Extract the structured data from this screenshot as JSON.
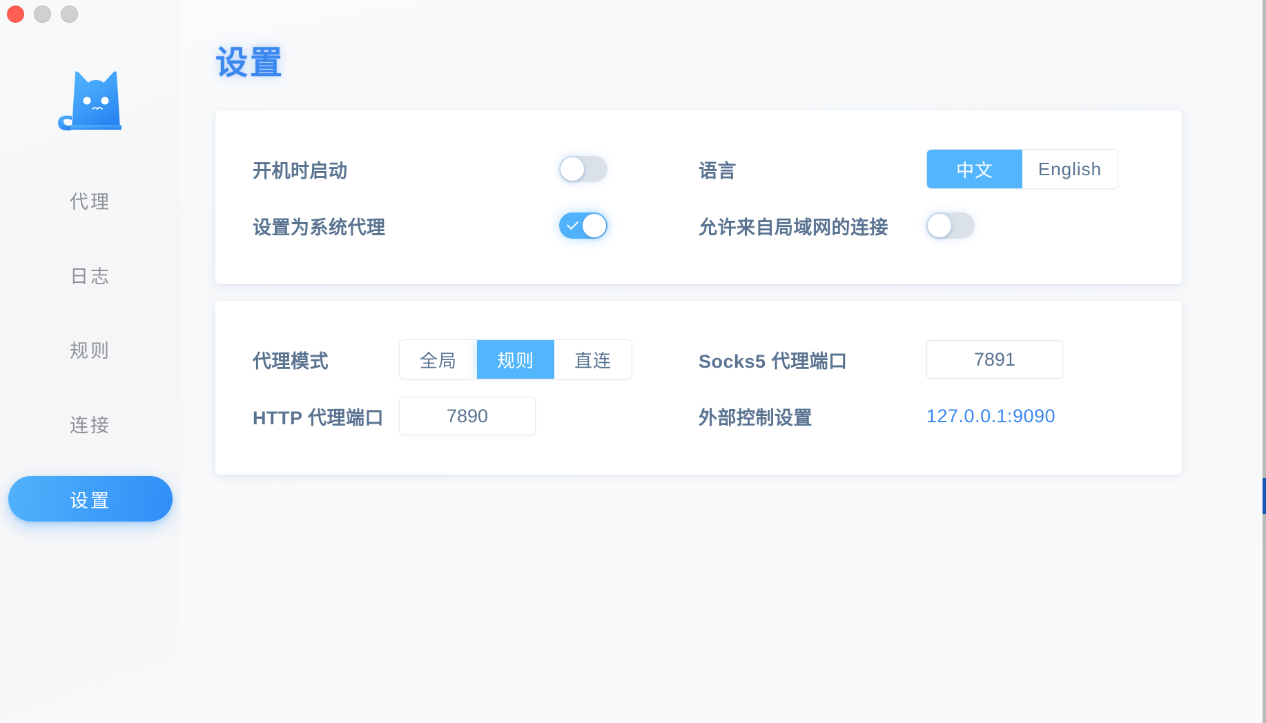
{
  "window": {
    "traffic_lights": [
      {
        "name": "close",
        "color": "#ff5f52"
      },
      {
        "name": "minimize",
        "color": "#d0d0d0"
      },
      {
        "name": "zoom",
        "color": "#d0d0d0"
      }
    ]
  },
  "sidebar": {
    "logo": "clash-cat-logo",
    "items": [
      {
        "label": "代理",
        "active": false
      },
      {
        "label": "日志",
        "active": false
      },
      {
        "label": "规则",
        "active": false
      },
      {
        "label": "连接",
        "active": false
      },
      {
        "label": "设置",
        "active": true
      }
    ]
  },
  "main": {
    "title": "设置",
    "general_card": {
      "startup": {
        "label": "开机时启动",
        "toggle_state": "off"
      },
      "language": {
        "label": "语言",
        "options": [
          "中文",
          "English"
        ],
        "selected": "中文"
      },
      "system_proxy": {
        "label": "设置为系统代理",
        "toggle_state": "on"
      },
      "allow_lan": {
        "label": "允许来自局域网的连接",
        "toggle_state": "off"
      }
    },
    "ports_card": {
      "proxy_mode": {
        "label": "代理模式",
        "options": [
          "全局",
          "规则",
          "直连"
        ],
        "selected": "规则"
      },
      "socks5_port": {
        "label": "Socks5 代理端口",
        "value": "7891"
      },
      "http_port": {
        "label": "HTTP 代理端口",
        "value": "7890"
      },
      "external_controller": {
        "label": "外部控制设置",
        "value": "127.0.0.1:9090"
      }
    }
  },
  "colors": {
    "accent": "#3b87f0",
    "toggle_on": "#4fb2fb",
    "segment_active": "#53b5fb",
    "label_text": "#5a7391",
    "nav_text": "#8e9296"
  }
}
